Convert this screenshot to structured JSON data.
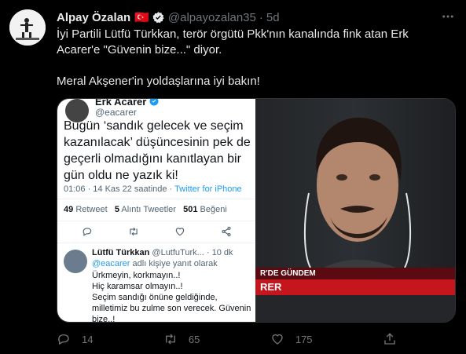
{
  "author": {
    "name": "Alpay Özalan",
    "flag": "🇹🇷",
    "handle": "@alpayozalan35",
    "separator": "·",
    "time": "5d"
  },
  "tweet": {
    "line1": "İyi Partili Lütfü Türkkan, terör örgütü Pkk'nın kanalında fink atan Erk Acarer'e \"Güvenin bize...\" diyor.",
    "line2": "Meral Akşener'in yoldaşlarına iyi bakın!"
  },
  "embedded": {
    "name": "Erk Acarer",
    "handle": "@eacarer",
    "text": "Bugün ‘sandık gelecek ve seçim kazanılacak’ düşüncesinin pek de geçerli olmadığını kanıtlayan bir gün oldu ne yazık ki!",
    "meta_time": "01:06 · 14 Kas 22 saatinde · ",
    "meta_source": "Twitter for iPhone",
    "retweets": "49",
    "retweets_label": "Retweet",
    "quotes": "5",
    "quotes_label": "Alıntı Tweetler",
    "likes": "501",
    "likes_label": "Beğeni"
  },
  "embedded_reply": {
    "name": "Lütfü Türkkan",
    "handle": "@LutfuTurk...",
    "time": "· 10 dk",
    "reply_handle": "@eacarer",
    "reply_suffix": " adlı kişiye yanıt olarak",
    "lines": [
      "Ürkmeyin, korkmayın..!",
      "Hiç karamsar olmayın..!",
      "Seçim sandığı önüne geldiğinde, milletimiz bu zulme son verecek. Güvenin bize..!"
    ]
  },
  "tv": {
    "banner_top": "R'DE GÜNDEM",
    "banner_name": "RER"
  },
  "actions": {
    "replies": "14",
    "retweets": "65",
    "likes": "175"
  },
  "colors": {
    "background": "#000000",
    "text": "#e7e9ea",
    "muted": "#71767b",
    "verified": "#1d9bf0",
    "tv_red": "#c4161c"
  }
}
